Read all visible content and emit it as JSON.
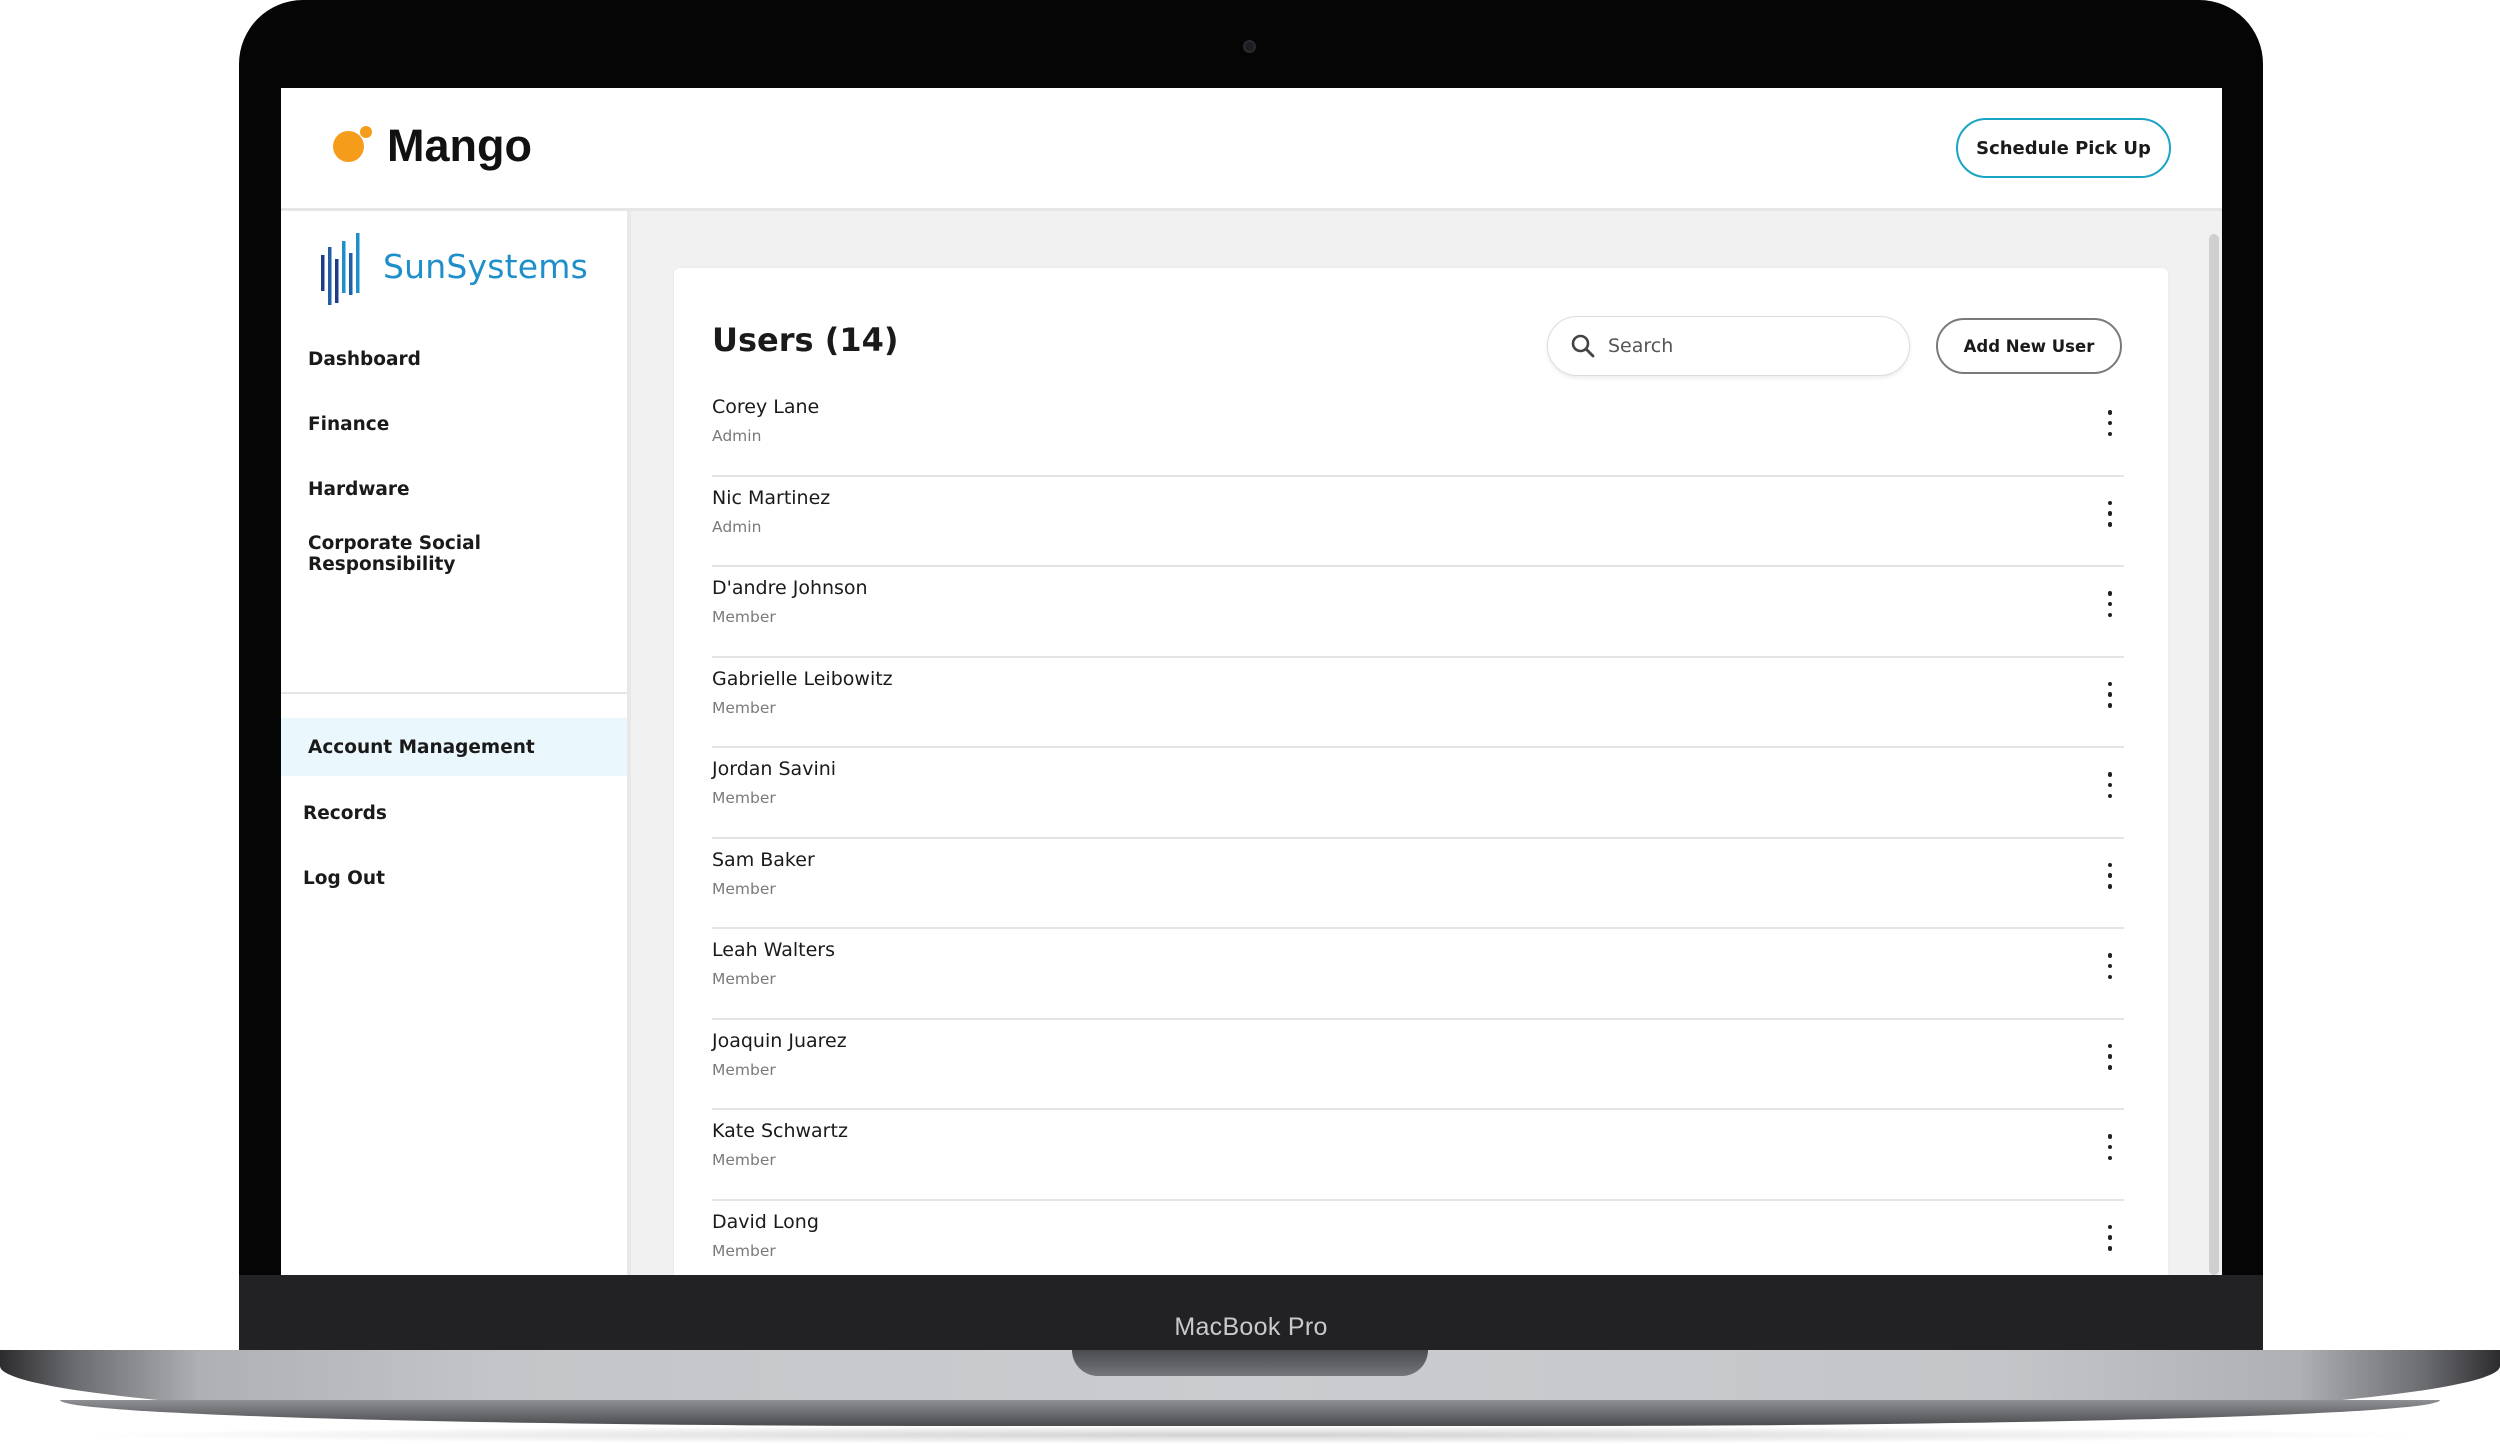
{
  "device": {
    "label": "MacBook Pro"
  },
  "header": {
    "brand": "Mango",
    "brand_color": "#f59c1a",
    "schedule_button": "Schedule Pick Up",
    "accent_color": "#1aa4c4"
  },
  "sidebar": {
    "company_logo": "SunSystems",
    "logo_color": "#1f8fc9",
    "items": [
      {
        "label": "Dashboard"
      },
      {
        "label": "Finance"
      },
      {
        "label": "Hardware"
      },
      {
        "label": "Corporate Social Responsibility"
      },
      {
        "label": "Account Management",
        "active": true
      },
      {
        "label": "Records"
      },
      {
        "label": "Log Out"
      }
    ]
  },
  "main": {
    "title": "Users (14)",
    "search": {
      "placeholder": "Search",
      "value": ""
    },
    "add_button": "Add New User",
    "users": [
      {
        "name": "Corey Lane",
        "role": "Admin"
      },
      {
        "name": "Nic Martinez",
        "role": "Admin"
      },
      {
        "name": "D'andre Johnson",
        "role": "Member"
      },
      {
        "name": "Gabrielle Leibowitz",
        "role": "Member"
      },
      {
        "name": "Jordan Savini",
        "role": "Member"
      },
      {
        "name": "Sam Baker",
        "role": "Member"
      },
      {
        "name": "Leah Walters",
        "role": "Member"
      },
      {
        "name": "Joaquin Juarez",
        "role": "Member"
      },
      {
        "name": "Kate Schwartz",
        "role": "Member"
      },
      {
        "name": "David Long",
        "role": "Member"
      }
    ]
  }
}
